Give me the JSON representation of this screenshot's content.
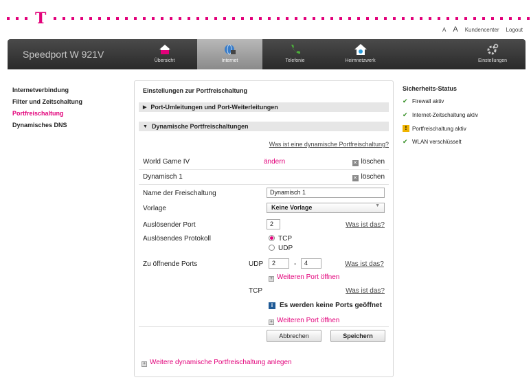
{
  "header": {
    "font_small": "A",
    "font_large": "A",
    "links": [
      "Kundencenter",
      "Logout"
    ],
    "brand_color": "#e2007a"
  },
  "nav": {
    "product": "Speedport W 921V",
    "items": [
      {
        "label": "Übersicht",
        "icon": "house-icon"
      },
      {
        "label": "Internet",
        "icon": "globe-icon",
        "active": true
      },
      {
        "label": "Telefonie",
        "icon": "phone-icon"
      },
      {
        "label": "Heimnetzwerk",
        "icon": "home-network-icon"
      }
    ],
    "settings": {
      "label": "Einstellungen",
      "icon": "gear-icon"
    }
  },
  "sidebar": {
    "items": [
      {
        "label": "Internetverbindung"
      },
      {
        "label": "Filter und Zeitschaltung"
      },
      {
        "label": "Portfreischaltung",
        "active": true
      },
      {
        "label": "Dynamisches DNS"
      }
    ]
  },
  "main": {
    "title": "Einstellungen zur Portfreischaltung",
    "section1": "Port-Umleitungen und Port-Weiterleitungen",
    "section2": "Dynamische Portfreischaltungen",
    "help_link": "Was ist eine dynamische Portfreischaltung?",
    "entry1": {
      "name": "World Game IV",
      "edit": "ändern",
      "delete": "löschen"
    },
    "entry2": {
      "name": "Dynamisch 1",
      "delete": "löschen"
    },
    "name_label": "Name der Freischaltung",
    "name_value": "Dynamisch 1",
    "template_label": "Vorlage",
    "template_value": "Keine Vorlage",
    "trigger_port_label": "Auslösender Port",
    "trigger_port_value": "2",
    "what_is_that": "Was ist das?",
    "protocol_label": "Auslösendes Protokoll",
    "protocol_tcp": "TCP",
    "protocol_udp": "UDP",
    "open_ports_label": "Zu öffnende Ports",
    "udp_label": "UDP",
    "udp_from": "2",
    "udp_dash": "-",
    "udp_to": "4",
    "more_port": "Weiteren Port öffnen",
    "tcp_label": "TCP",
    "no_ports_info": "Es werden keine Ports geöffnet",
    "cancel": "Abbrechen",
    "save": "Speichern",
    "add_more": "Weitere dynamische Portfreischaltung anlegen"
  },
  "status": {
    "title": "Sicherheits-Status",
    "items": [
      {
        "label": "Firewall aktiv",
        "state": "ok"
      },
      {
        "label": "Internet-Zeitschaltung aktiv",
        "state": "ok"
      },
      {
        "label": "Portfreischaltung aktiv",
        "state": "warning"
      },
      {
        "label": "WLAN verschlüsselt",
        "state": "ok"
      }
    ]
  }
}
